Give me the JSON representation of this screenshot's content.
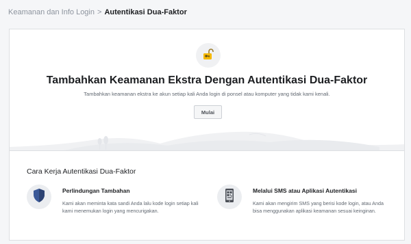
{
  "breadcrumb": {
    "parent": "Keamanan dan Info Login",
    "separator": ">",
    "current": "Autentikasi Dua-Faktor"
  },
  "hero": {
    "icon": "unlocked-padlock-icon",
    "title": "Tambahkan Keamanan Ekstra Dengan Autentikasi Dua-Faktor",
    "subtitle": "Tambahkan keamanan ekstra ke akun setiap kali Anda login di ponsel atau komputer yang tidak kami kenali.",
    "button_label": "Mulai"
  },
  "how_it_works": {
    "title": "Cara Kerja Autentikasi Dua-Faktor",
    "features": [
      {
        "icon": "shield-icon",
        "title": "Perlindungan Tambahan",
        "description": "Kami akan meminta kata sandi Anda lalu kode login setiap kali kami menemukan login yang mencurigakan."
      },
      {
        "icon": "phone-qr-icon",
        "title": "Melalui SMS atau Aplikasi Autentikasi",
        "description": "Kami akan mengirim SMS yang berisi kode login, atau Anda bisa menggunakan aplikasi keamanan sesuai keinginan."
      }
    ]
  },
  "colors": {
    "page_bg": "#f5f6f8",
    "card_bg": "#ffffff",
    "border": "#dddfe2",
    "lock_gold": "#f5b800",
    "shield_blue": "#3b5998"
  }
}
